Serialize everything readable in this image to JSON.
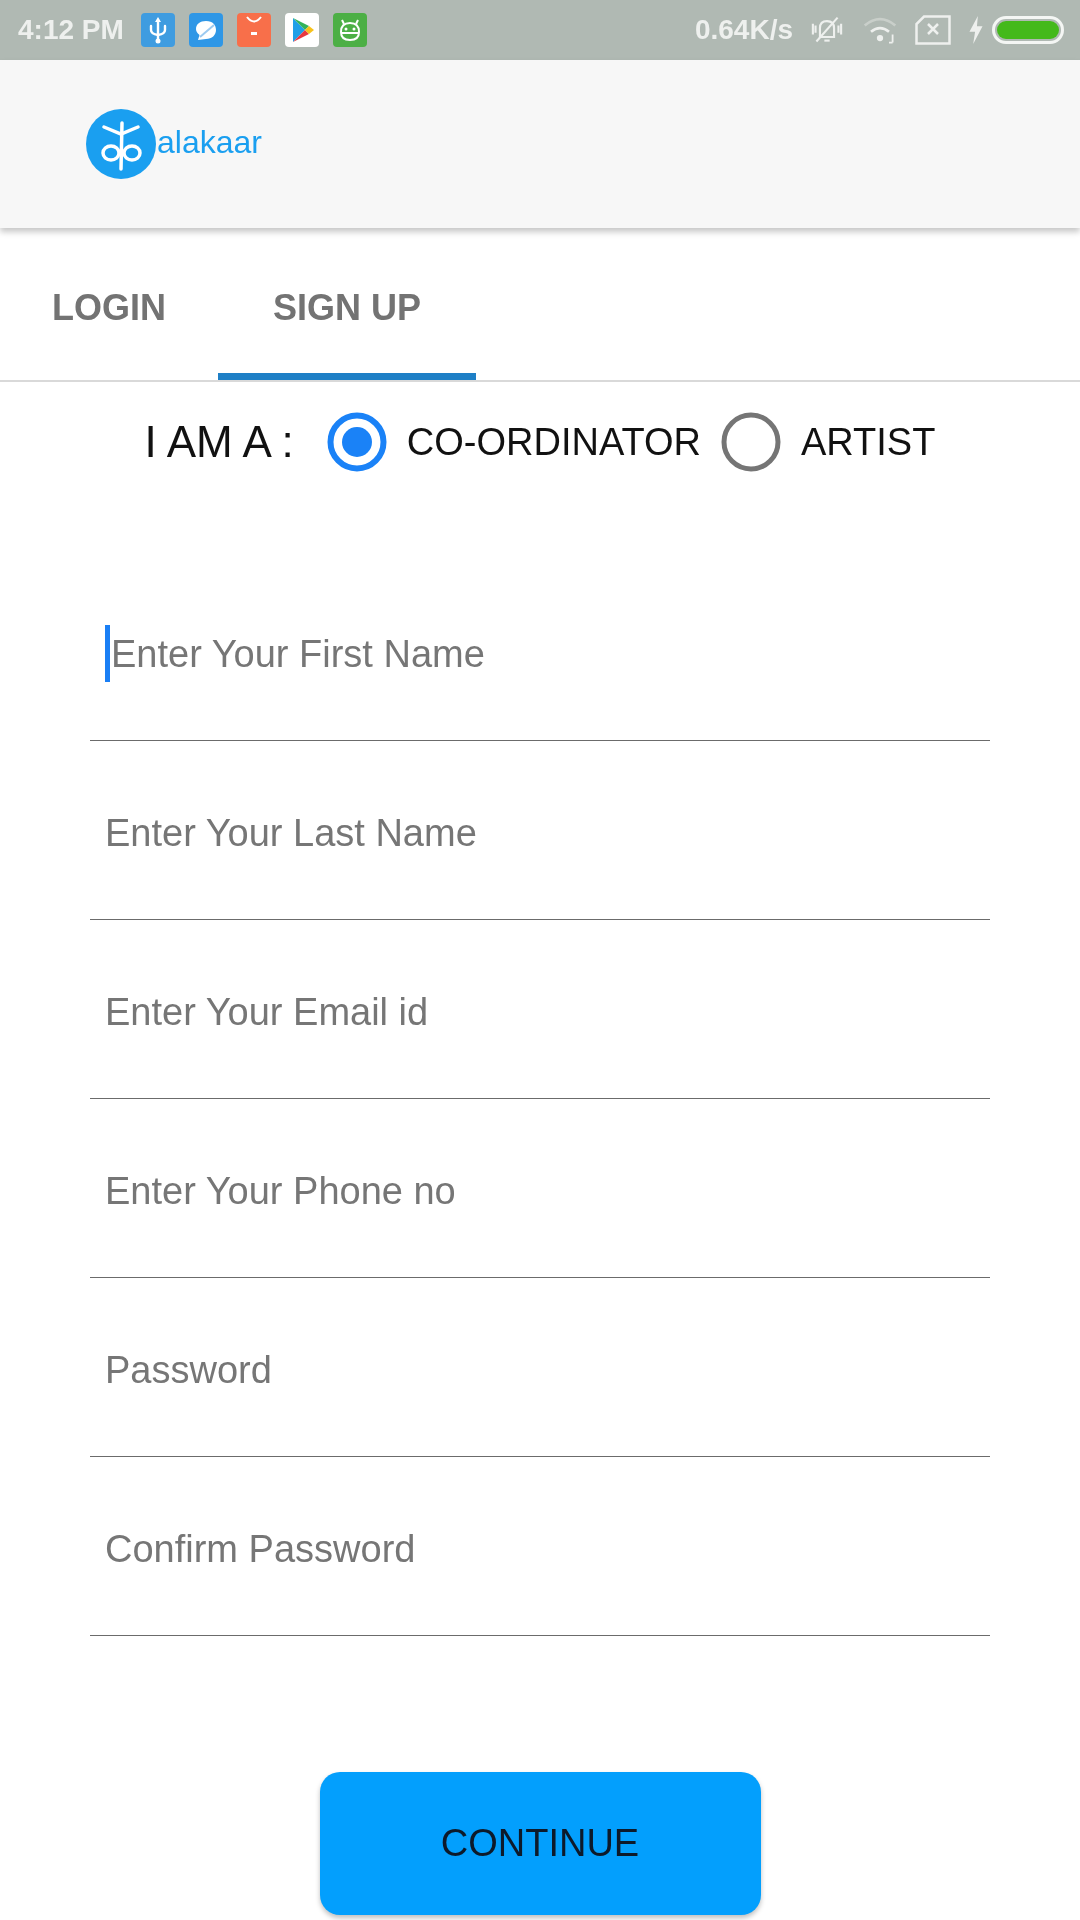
{
  "status_bar": {
    "time": "4:12 PM",
    "net_speed": "0.64K/s"
  },
  "app_bar": {
    "logo_text": "alakaar"
  },
  "tabs": [
    {
      "label": "LOGIN",
      "selected": false
    },
    {
      "label": "SIGN UP",
      "selected": true
    }
  ],
  "role": {
    "label": "I AM A :",
    "options": [
      {
        "label": "CO-ORDINATOR",
        "selected": true
      },
      {
        "label": "ARTIST",
        "selected": false
      }
    ]
  },
  "fields": [
    {
      "placeholder": "Enter Your First Name",
      "focused": true
    },
    {
      "placeholder": "Enter Your Last Name",
      "focused": false
    },
    {
      "placeholder": "Enter Your Email id",
      "focused": false
    },
    {
      "placeholder": "Enter Your Phone no",
      "focused": false
    },
    {
      "placeholder": "Password",
      "focused": false
    },
    {
      "placeholder": "Confirm Password",
      "focused": false
    }
  ],
  "button": {
    "label": "CONTINUE"
  }
}
